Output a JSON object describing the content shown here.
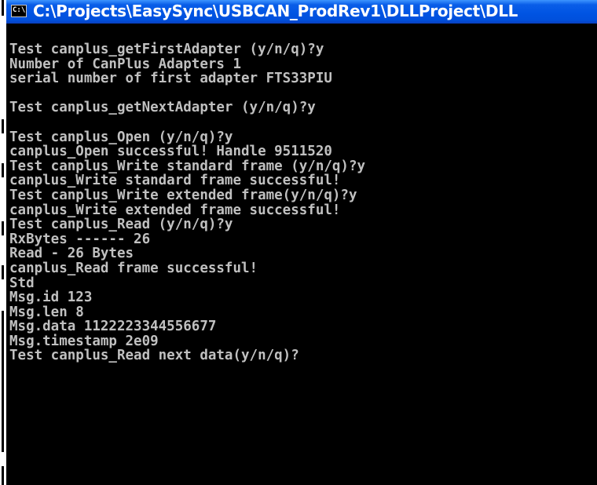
{
  "window": {
    "title": "C:\\Projects\\EasySync\\USBCAN_ProdRev1\\DLLProject\\DLL",
    "icon_label": "C:\\",
    "icon": "console-icon"
  },
  "console": {
    "lines": [
      "Test canplus_getFirstAdapter (y/n/q)?y",
      "Number of CanPlus Adapters 1",
      "serial number of first adapter FTS33PIU",
      "",
      "Test canplus_getNextAdapter (y/n/q)?y",
      "",
      "Test canplus_Open (y/n/q)?y",
      "canplus_Open successful! Handle 9511520",
      "Test canplus_Write standard frame (y/n/q)?y",
      "canplus_Write standard frame successful!",
      "Test canplus_Write extended frame(y/n/q)?y",
      "canplus_Write extended frame successful!",
      "Test canplus_Read (y/n/q)?y",
      "RxBytes ------ 26",
      "Read - 26 Bytes",
      "canplus_Read frame successful!",
      "Std",
      "Msg.id 123",
      "Msg.len 8",
      "Msg.data 1122223344556677",
      "Msg.timestamp 2e09",
      "Test canplus_Read next data(y/n/q)?"
    ]
  },
  "colors": {
    "console_bg": "#000000",
    "console_fg": "#c0c0c0",
    "titlebar": "#0054e3"
  }
}
